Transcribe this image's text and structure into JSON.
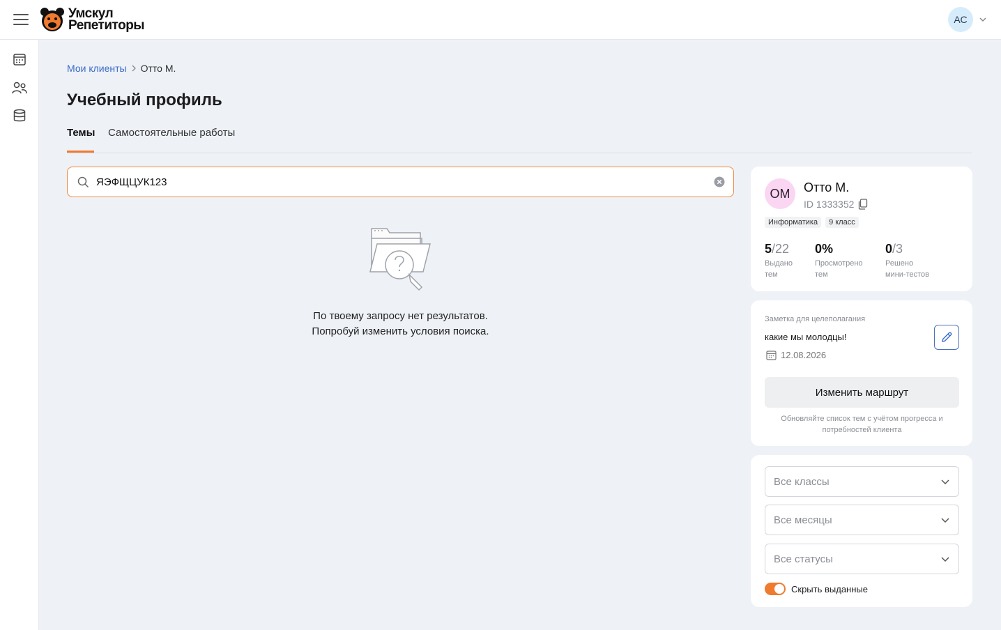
{
  "header": {
    "brand_line1": "Умскул",
    "brand_line2": "Репетиторы",
    "user_initials": "АС"
  },
  "breadcrumb": {
    "parent": "Мои клиенты",
    "current": "Отто М."
  },
  "page": {
    "title": "Учебный профиль"
  },
  "tabs": [
    {
      "label": "Темы",
      "active": true
    },
    {
      "label": "Самостоятельные работы",
      "active": false
    }
  ],
  "search": {
    "value": "ЯЭФЩЦУК123"
  },
  "empty_state": {
    "line1": "По твоему запросу нет результатов.",
    "line2": "Попробуй изменить условия поиска."
  },
  "client": {
    "initials": "ОМ",
    "name": "Отто М.",
    "id_text": "ID 1333352",
    "tags": [
      "Информатика",
      "9 класс"
    ],
    "stats": [
      {
        "num": "5",
        "den": "/22",
        "label1": "Выдано",
        "label2": "тем"
      },
      {
        "num": "0%",
        "den": "",
        "label1": "Просмотрено",
        "label2": "тем"
      },
      {
        "num": "0",
        "den": "/3",
        "label1": "Решено",
        "label2": "мини-тестов"
      }
    ]
  },
  "goal_note": {
    "label": "Заметка для целеполагания",
    "text": "какие мы молодцы!",
    "date": "12.08.2026",
    "route_button": "Изменить маршрут",
    "hint": "Обновляйте список тем с учётом прогресса и потребностей клиента"
  },
  "filters": {
    "classes": "Все классы",
    "months": "Все месяцы",
    "statuses": "Все статусы",
    "hide_issued_label": "Скрыть выданные",
    "hide_issued_on": true
  },
  "colors": {
    "accent": "#f07a2e",
    "link": "#3a6cc8",
    "background": "#eef1f6"
  }
}
